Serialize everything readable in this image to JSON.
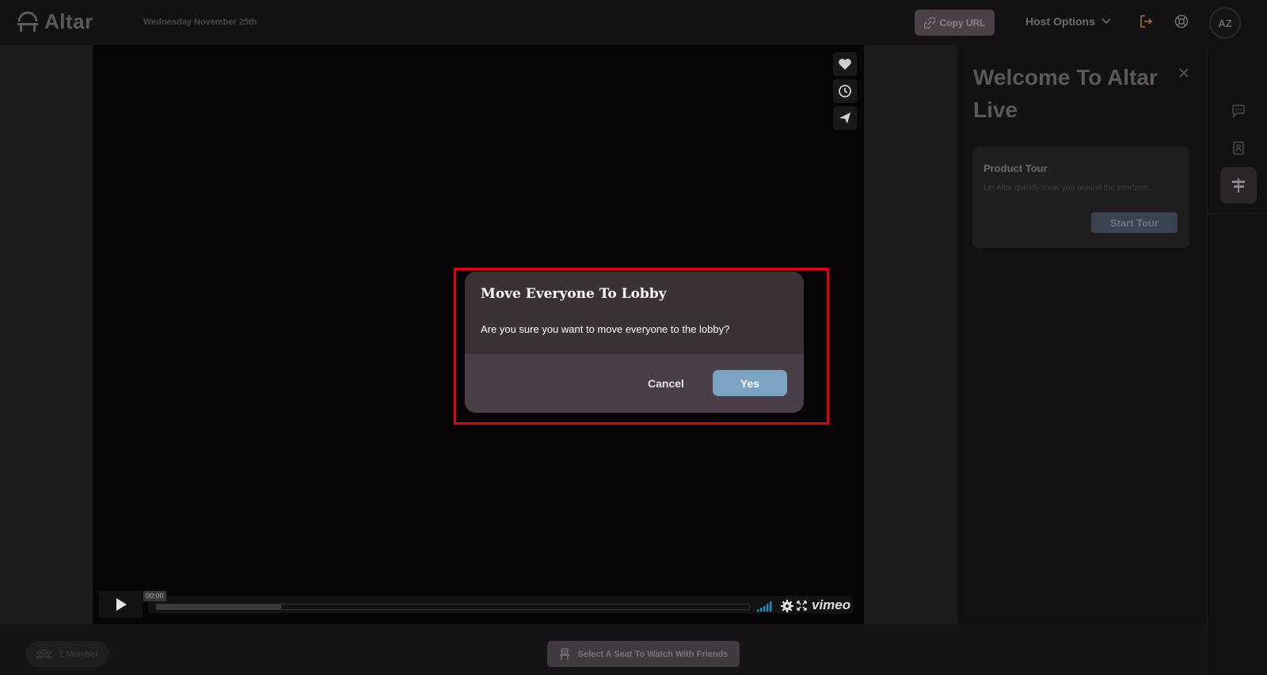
{
  "header": {
    "logo_text": "Altar",
    "date": "Wednesday November 25th",
    "copy_url_label": "Copy URL",
    "host_options_label": "Host Options",
    "avatar_initials": "AZ"
  },
  "video": {
    "time": "00:00",
    "progress_fraction": 0.21,
    "brand": "vimeo"
  },
  "panel": {
    "title": "Welcome To Altar Live",
    "tour_title": "Product Tour",
    "tour_desc": "Let Altar quickly show you around the interface.",
    "tour_button": "Start Tour"
  },
  "bottom": {
    "members": "1 Member",
    "seat_button": "Select A Seat To Watch With Friends"
  },
  "modal": {
    "title": "Move Everyone To Lobby",
    "message": "Are you sure you want to move everyone to the lobby?",
    "cancel_label": "Cancel",
    "confirm_label": "Yes"
  },
  "colors": {
    "confirm": "#7ca3c2",
    "highlight": "#e0000e",
    "modal_body": "#3a3237",
    "modal_footer": "#4a3f48"
  }
}
